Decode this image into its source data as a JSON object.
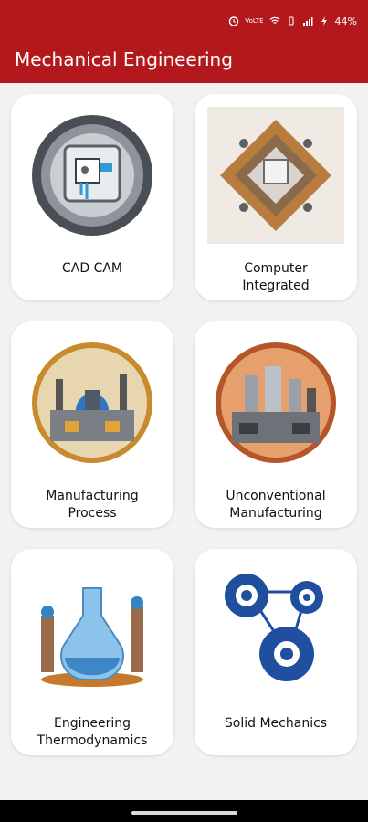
{
  "status": {
    "network": "VoLTE",
    "battery": "44%"
  },
  "app": {
    "title": "Mechanical Engineering"
  },
  "cards": [
    {
      "label": "CAD CAM",
      "icon": "cad-cam-icon"
    },
    {
      "label": "Computer\nIntegrated",
      "icon": "computer-integrated-icon"
    },
    {
      "label": "Manufacturing\nProcess",
      "icon": "manufacturing-process-icon"
    },
    {
      "label": "Unconventional\nManufacturing",
      "icon": "unconventional-manufacturing-icon"
    },
    {
      "label": "Engineering\nThermodynamics",
      "icon": "engineering-thermodynamics-icon"
    },
    {
      "label": "Solid Mechanics",
      "icon": "solid-mechanics-icon"
    }
  ],
  "colors": {
    "appbar": "#b3181c",
    "gear": "#1f4f9e"
  }
}
